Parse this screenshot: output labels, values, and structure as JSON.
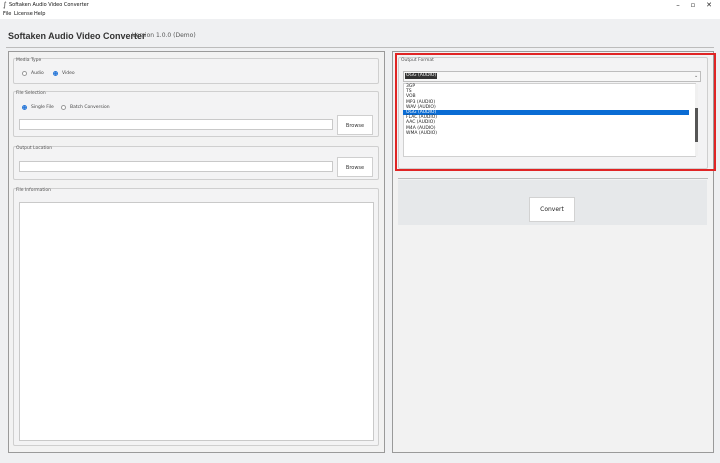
{
  "window": {
    "title": "Softaken Audio Video Converter"
  },
  "menu": [
    "File",
    "License",
    "Help"
  ],
  "app": {
    "name": "Softaken Audio Video Converter",
    "version": "Version 1.0.0 (Demo)"
  },
  "media_type": {
    "label": "Media Type",
    "options": [
      "Audio",
      "Video"
    ],
    "selected": "Video"
  },
  "file_selection": {
    "label": "File Selection",
    "options": [
      "Single File",
      "Batch Conversion"
    ],
    "selected": "Single File",
    "path_value": "",
    "browse_label": "Browse"
  },
  "output_location": {
    "label": "Output Location",
    "path_value": "",
    "browse_label": "Browse"
  },
  "file_information": {
    "label": "File Information"
  },
  "output_format": {
    "label": "Output Format",
    "selected": "OGG (AUDIO)",
    "options": [
      "3GP",
      "TS",
      "VOB",
      "MP3 (AUDIO)",
      "WAV (AUDIO)",
      "OGG (AUDIO)",
      "FLAC (AUDIO)",
      "AAC (AUDIO)",
      "M4A (AUDIO)",
      "WMA (AUDIO)"
    ],
    "highlighted_index": 5
  },
  "convert": {
    "label": "Convert"
  },
  "colors": {
    "accent": "#0a6cd4",
    "highlight_border": "#e02424"
  }
}
